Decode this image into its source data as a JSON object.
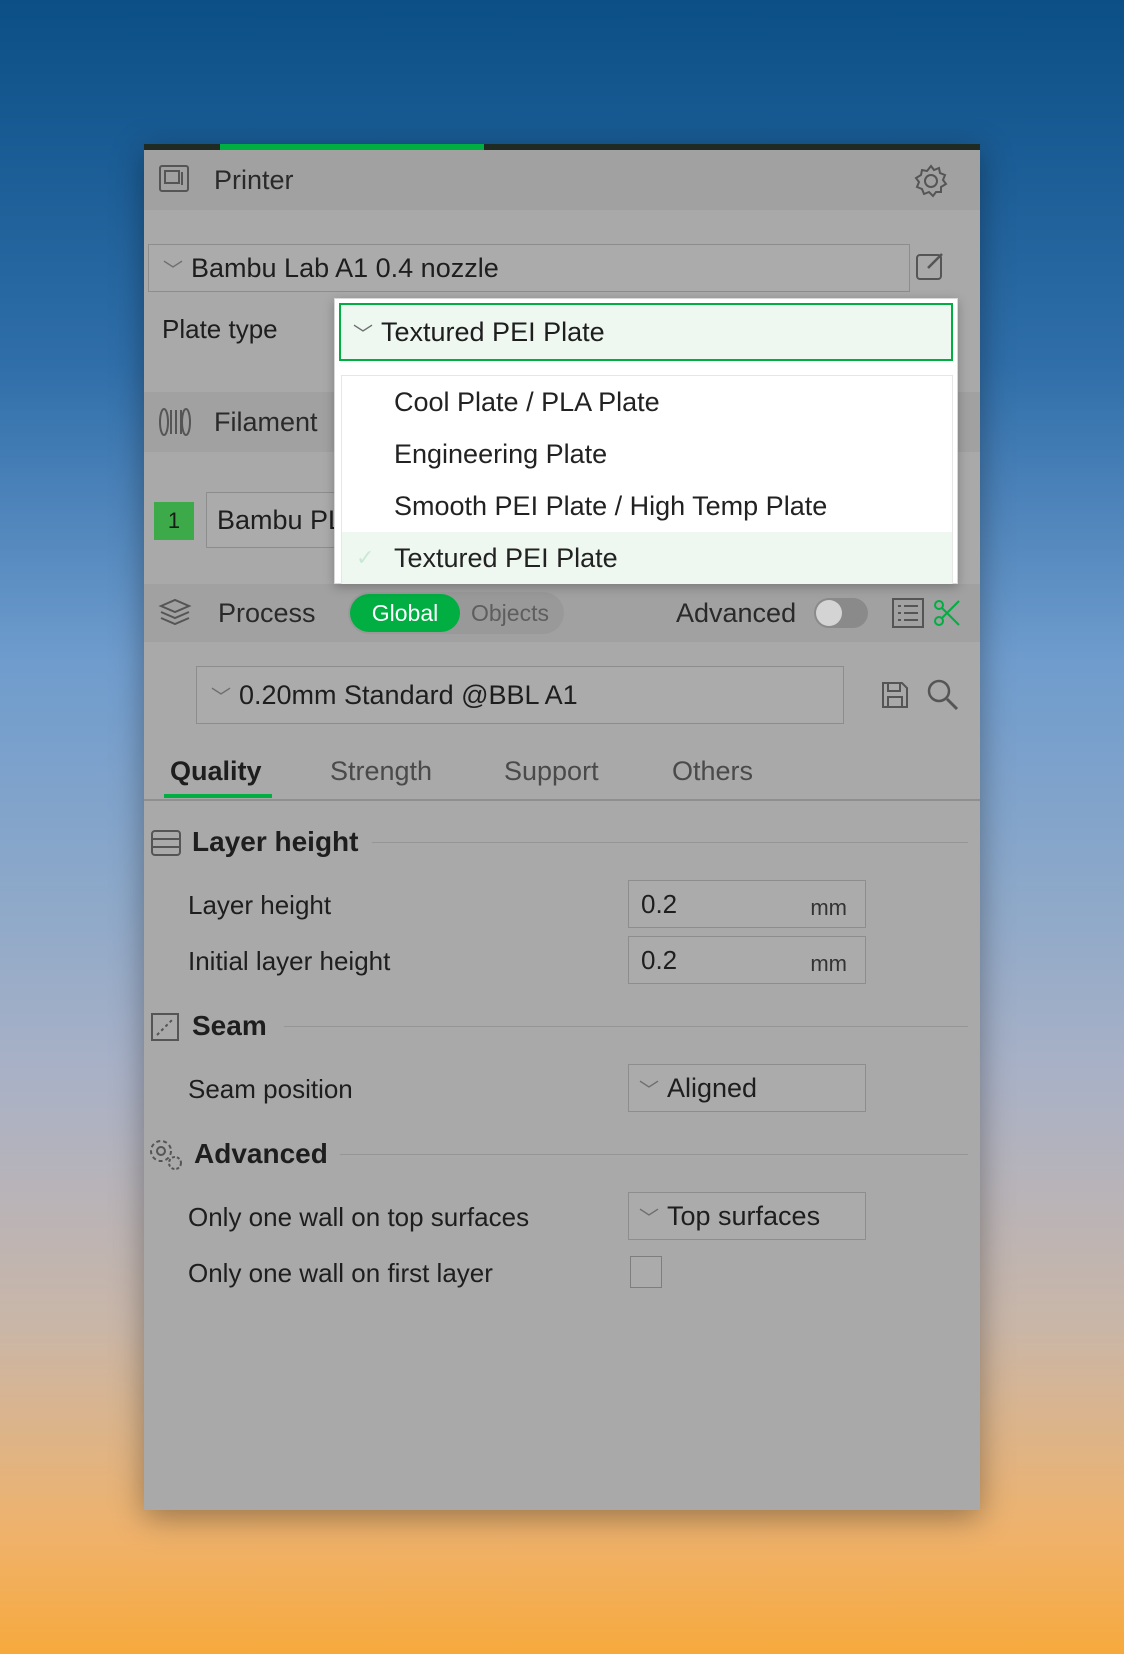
{
  "printer": {
    "title": "Printer",
    "preset": "Bambu Lab A1 0.4 nozzle",
    "plate_type_label": "Plate type",
    "plate_type_value": "Textured PEI Plate",
    "plate_options": [
      {
        "label": "Cool Plate / PLA Plate",
        "selected": false
      },
      {
        "label": "Engineering Plate",
        "selected": false
      },
      {
        "label": "Smooth PEI Plate / High Temp Plate",
        "selected": false
      },
      {
        "label": "Textured PEI Plate",
        "selected": true
      }
    ]
  },
  "filament": {
    "title": "Filament",
    "slot_number": "1",
    "preset": "Bambu PL"
  },
  "process": {
    "title": "Process",
    "toggle_global": "Global",
    "toggle_objects": "Objects",
    "advanced_label": "Advanced",
    "advanced_on": false,
    "preset": "0.20mm Standard @BBL A1",
    "tabs": [
      "Quality",
      "Strength",
      "Support",
      "Others"
    ],
    "active_tab": "Quality"
  },
  "groups": {
    "layer_height": {
      "title": "Layer height",
      "layer_height_label": "Layer height",
      "layer_height_value": "0.2",
      "initial_layer_height_label": "Initial layer height",
      "initial_layer_height_value": "0.2",
      "unit": "mm"
    },
    "seam": {
      "title": "Seam",
      "seam_position_label": "Seam position",
      "seam_position_value": "Aligned"
    },
    "advanced": {
      "title": "Advanced",
      "one_wall_top_label": "Only one wall on top surfaces",
      "one_wall_top_value": "Top surfaces",
      "one_wall_first_label": "Only one wall on first layer",
      "one_wall_first_checked": false
    }
  },
  "colors": {
    "accent": "#00ae42",
    "panel": "#a9a9a9",
    "filament_slot": "#3daa4a"
  }
}
